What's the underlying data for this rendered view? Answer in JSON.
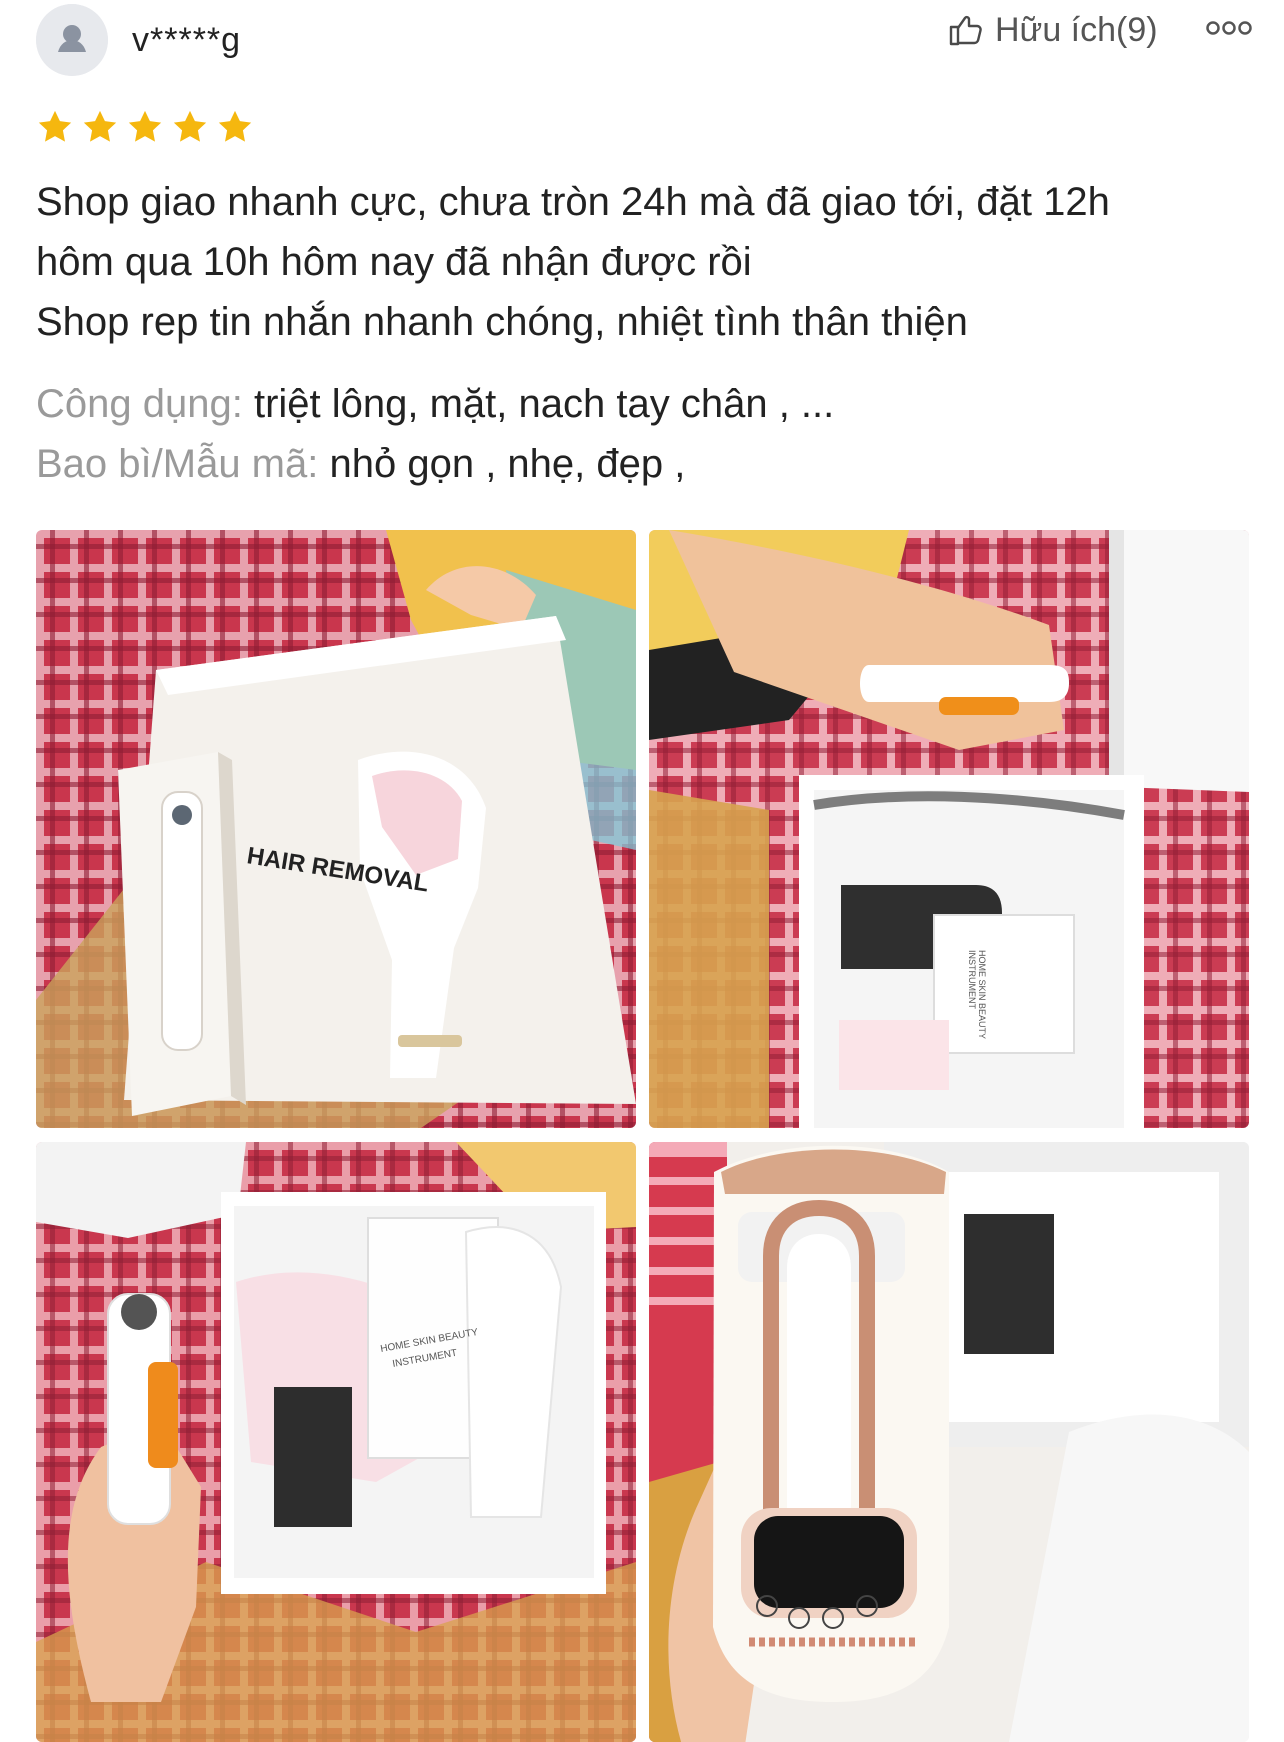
{
  "review": {
    "username": "v*****g",
    "helpful_label": "Hữu ích(9)",
    "rating": 5,
    "text_lines": [
      "Shop giao nhanh cực, chưa tròn 24h mà đã giao tới, đặt 12h",
      "hôm qua 10h hôm nay đã nhận được rồi",
      "Shop rep tin nhắn nhanh chóng, nhiệt tình thân thiện"
    ],
    "attributes": [
      {
        "label": "Công dụng:",
        "value": "triệt lông, mặt, nach tay chân , ..."
      },
      {
        "label": "Bao bì/Mẫu mã:",
        "value": "nhỏ gọn , nhẹ, đẹp  ,"
      }
    ],
    "photos": [
      {
        "box_text": "HAIR REMOVAL"
      },
      {
        "card_text_1": "HOME SKIN BEAUTY",
        "card_text_2": "INSTRUMENT"
      },
      {
        "card_text_1": "HOME SKIN BEAUTY",
        "card_text_2": "INSTRUMENT"
      },
      {}
    ]
  },
  "colors": {
    "star": "#f5b70f",
    "text": "#222222",
    "label": "#9a9a9a",
    "avatar_bg": "#e7e9ed",
    "avatar_icon": "#8b93a1"
  },
  "icons": {
    "avatar": "person-icon",
    "helpful": "thumbs-up-icon",
    "more": "more-icon",
    "rating": "star-icon"
  }
}
